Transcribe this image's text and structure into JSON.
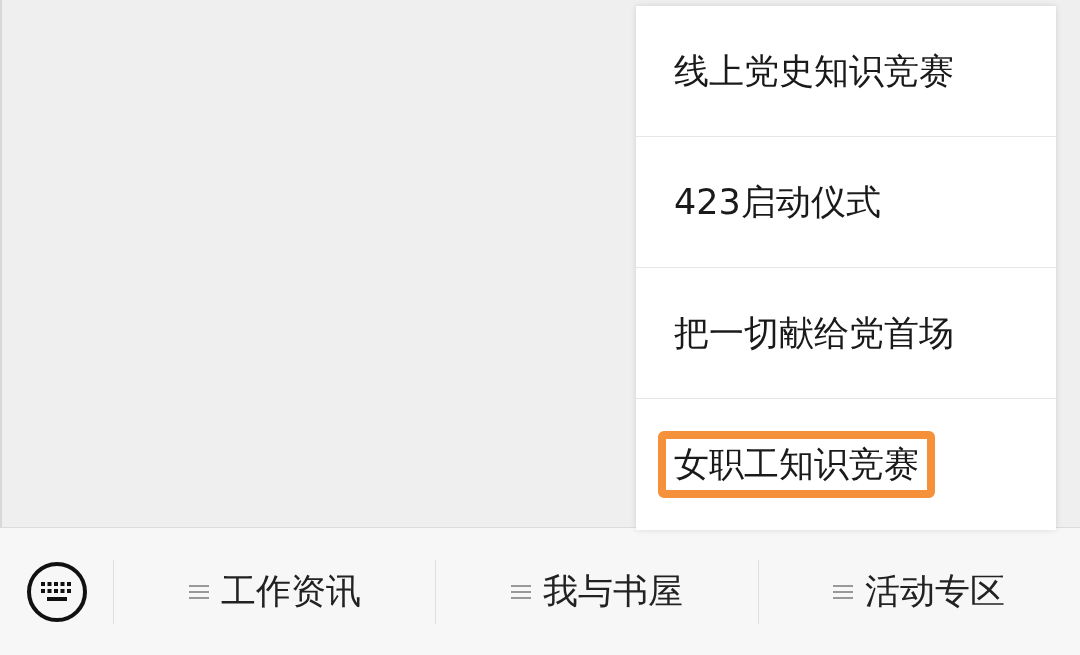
{
  "menu_popup": {
    "items": [
      {
        "label": "线上党史知识竞赛",
        "highlighted": false
      },
      {
        "label": "423启动仪式",
        "highlighted": false
      },
      {
        "label": "把一切献给党首场",
        "highlighted": false
      },
      {
        "label": "女职工知识竞赛",
        "highlighted": true
      }
    ]
  },
  "bottom_bar": {
    "tabs": [
      {
        "label": "工作资讯"
      },
      {
        "label": "我与书屋"
      },
      {
        "label": "活动专区"
      }
    ]
  }
}
